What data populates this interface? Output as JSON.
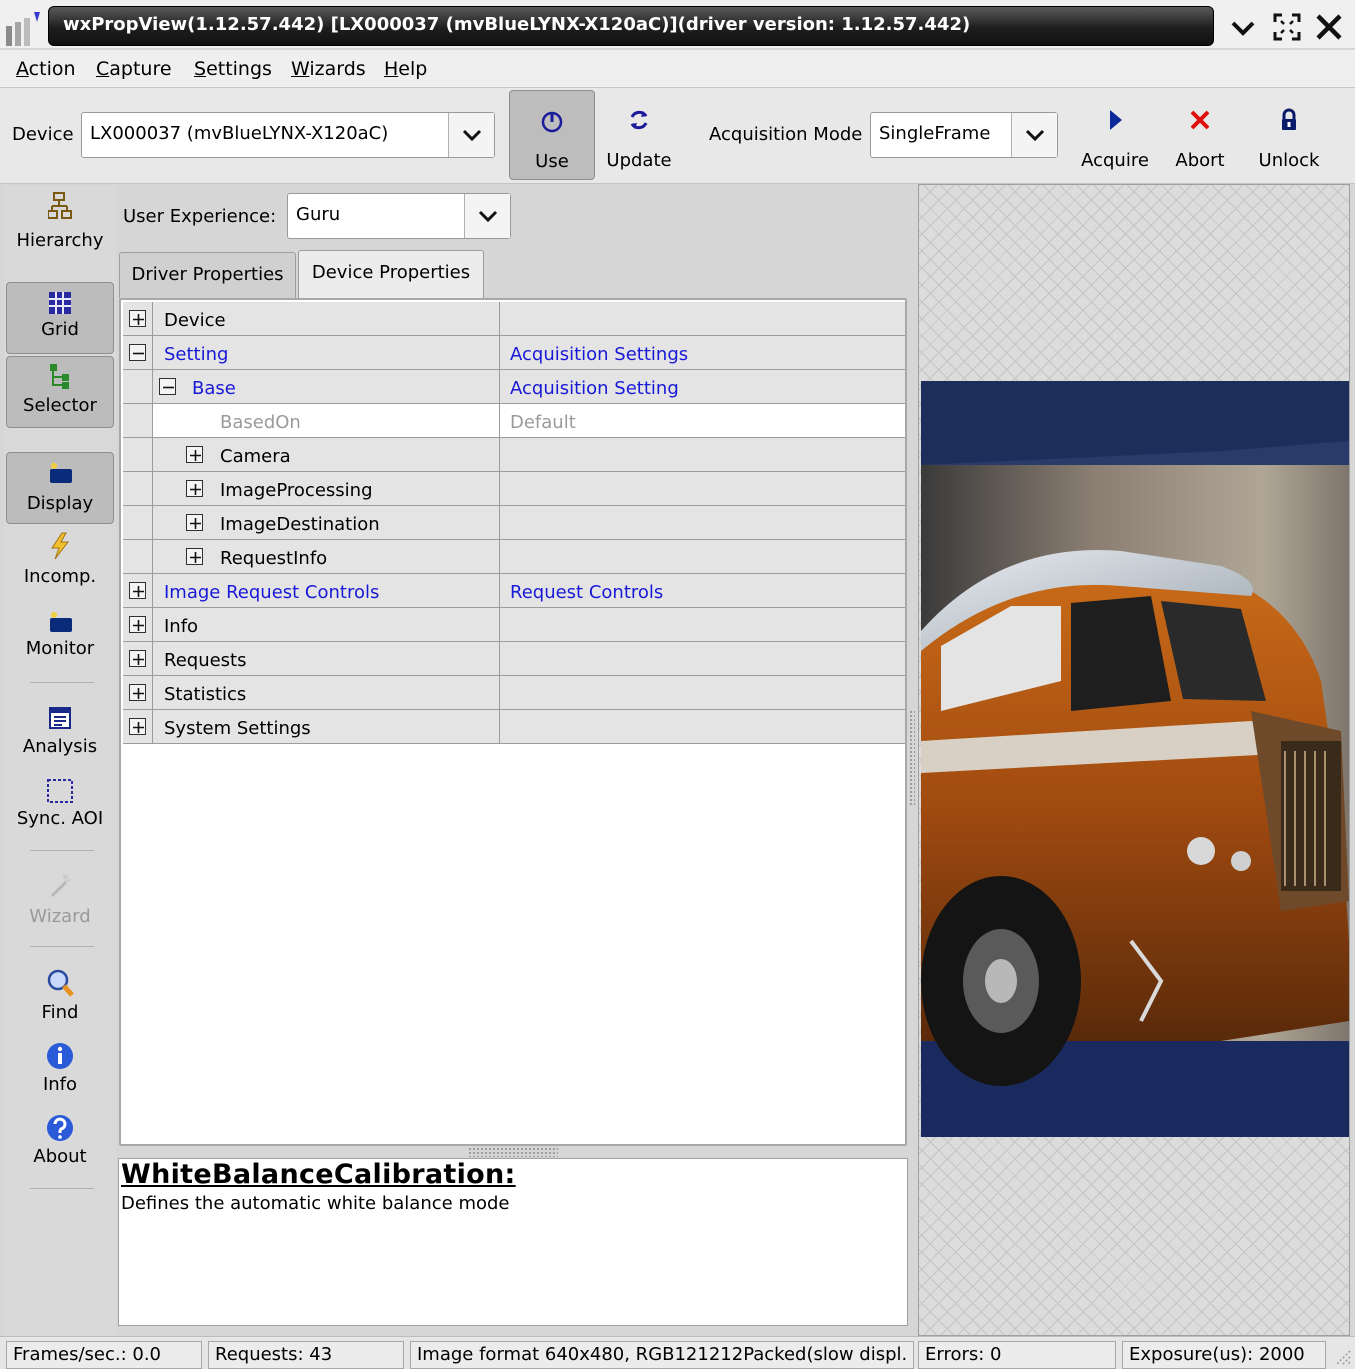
{
  "window": {
    "title": "wxPropView(1.12.57.442) [LX000037 (mvBlueLYNX-X120aC)](driver version: 1.12.57.442)"
  },
  "menu": {
    "items": [
      {
        "label": "Action",
        "mnemonic": "A"
      },
      {
        "label": "Capture",
        "mnemonic": "C"
      },
      {
        "label": "Settings",
        "mnemonic": "S"
      },
      {
        "label": "Wizards",
        "mnemonic": "W"
      },
      {
        "label": "Help",
        "mnemonic": "H"
      }
    ]
  },
  "toolbar": {
    "device_label": "Device",
    "device_value": "LX000037 (mvBlueLYNX-X120aC)",
    "use_label": "Use",
    "update_label": "Update",
    "acq_mode_label": "Acquisition Mode",
    "acq_mode_value": "SingleFrame",
    "acquire_label": "Acquire",
    "abort_label": "Abort",
    "unlock_label": "Unlock"
  },
  "sidebar": {
    "hierarchy": "Hierarchy",
    "grid": "Grid",
    "selector": "Selector",
    "display": "Display",
    "incomp": "Incomp.",
    "monitor": "Monitor",
    "analysis": "Analysis",
    "sync_aoi": "Sync. AOI",
    "wizard": "Wizard",
    "find": "Find",
    "info": "Info",
    "about": "About"
  },
  "panel": {
    "ux_label": "User Experience:",
    "ux_value": "Guru",
    "tabs": {
      "driver": "Driver Properties",
      "device": "Device Properties"
    }
  },
  "grid": {
    "rows": [
      {
        "name": "Device",
        "value": ""
      },
      {
        "name": "Setting",
        "value": "Acquisition Settings"
      },
      {
        "name": "Base",
        "value": "Acquisition Setting"
      },
      {
        "name": "BasedOn",
        "value": "Default"
      },
      {
        "name": "Camera",
        "value": ""
      },
      {
        "name": "ImageProcessing",
        "value": ""
      },
      {
        "name": "ImageDestination",
        "value": ""
      },
      {
        "name": "RequestInfo",
        "value": ""
      },
      {
        "name": "Image Request Controls",
        "value": "Request Controls"
      },
      {
        "name": "Info",
        "value": ""
      },
      {
        "name": "Requests",
        "value": ""
      },
      {
        "name": "Statistics",
        "value": ""
      },
      {
        "name": "System Settings",
        "value": ""
      }
    ]
  },
  "description": {
    "title": "WhiteBalanceCalibration:",
    "text": "Defines the automatic white balance mode"
  },
  "status": {
    "fps": "Frames/sec.: 0.0",
    "requests": "Requests: 43",
    "format": "Image format 640x480, RGB121212Packed(slow displ.",
    "errors": "Errors: 0",
    "exposure": "Exposure(us): 2000"
  },
  "colors": {
    "link_blue": "#1818d8",
    "abort_red": "#e01010",
    "acquire_blue": "#0a2a9a"
  }
}
